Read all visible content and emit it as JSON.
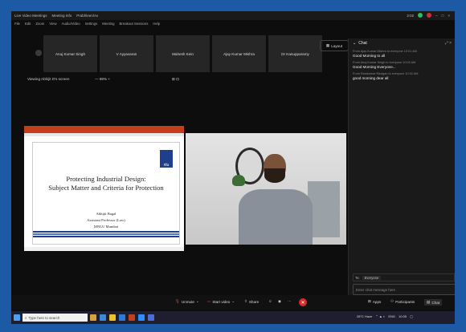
{
  "window": {
    "title": "Live Video Meetings",
    "tab": "Meeting Info",
    "host": "Prabhleen/Av",
    "time_right": "2:02"
  },
  "menu": [
    "File",
    "Edit",
    "Zoom",
    "View",
    "Audio/Video",
    "Settings",
    "Meeting",
    "Breakout Sessions",
    "Help"
  ],
  "participants_strip": [
    "Anuj Kumar Singh",
    "V Ayyavaran",
    "Mahesh Kein",
    "Ajay Kumar Mishra",
    "Dr Kanupparamy"
  ],
  "layout_button": "Layout",
  "viewing": "Viewing Abhijit D's screen",
  "zoom": "— 89% +",
  "slide": {
    "title_line1": "Protecting Industrial Design:",
    "title_line2": "Subject Matter and Criteria for Protection",
    "author": "Abhijit Bagal",
    "role": "Assistant Professor (Law)",
    "institution": "MNLU Mumbai",
    "logo_text": "nlu"
  },
  "chat": {
    "header": "Chat",
    "messages": [
      {
        "from": "From Ajay Kumar Mishra to everyone   10:01 AM",
        "text": "Good Morning to all"
      },
      {
        "from": "From Anuj Kumar Singh to everyone   10:02 AM",
        "text": "Good Morning Everyone..."
      },
      {
        "from": "From Ramkumar Ravigan to everyone   10:02 AM",
        "text": "good morning dear all"
      }
    ],
    "to_label": "To:",
    "to_value": "Everyone",
    "placeholder": "Enter chat message here"
  },
  "toolbar": {
    "unmute": "Unmute",
    "start_video": "Start video",
    "share": "Share",
    "apps": "Apps",
    "participants": "Participants",
    "chat": "Chat"
  },
  "taskbar": {
    "search_placeholder": "Type here to search",
    "weather": "28°C Haze",
    "lang": "ENG",
    "time": "10:05"
  }
}
